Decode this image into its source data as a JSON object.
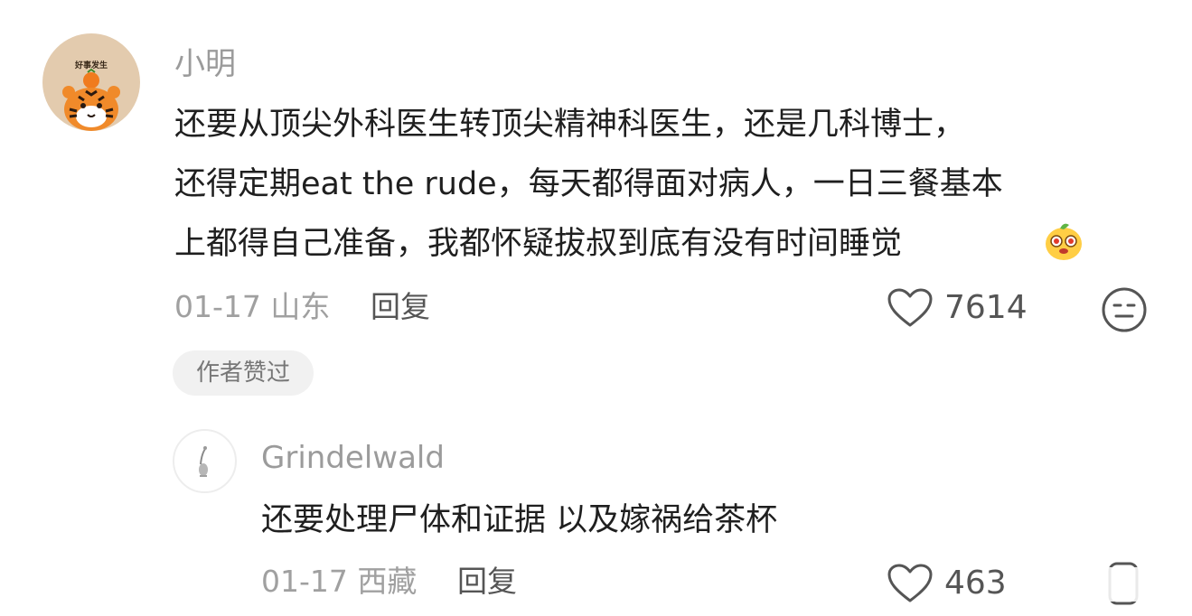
{
  "comment": {
    "username": "小明",
    "avatar_text": "好事发生",
    "avatar_icon": "tiger-avatar-icon",
    "lines": [
      "还要从顶尖外科医生转顶尖精神科医生，还是几科博士，",
      "还得定期eat the rude，每天都得面对病人，一日三餐基本",
      "上都得自己准备，我都怀疑拔叔到底有没有时间睡觉"
    ],
    "emoji": "mango-emoji-icon",
    "date": "01-17",
    "location": "山东",
    "reply_label": "回复",
    "like_count": "7614",
    "like_icon": "heart-outline-icon",
    "reaction_icon": "neutral-face-icon",
    "badge": "作者赞过"
  },
  "reply": {
    "username": "Grindelwald",
    "avatar_icon": "sketch-avatar-icon",
    "text": "还要处理尸体和证据 以及嫁祸给茶杯",
    "date": "01-17",
    "location": "西藏",
    "reply_label": "回复",
    "like_count": "463",
    "like_icon": "heart-outline-icon",
    "extra_icon": "dislike-icon"
  },
  "colors": {
    "text_primary": "#1f1f1f",
    "text_meta": "#a0a0a0",
    "text_name": "#9b9b9b",
    "badge_bg": "#f1f1f1"
  }
}
